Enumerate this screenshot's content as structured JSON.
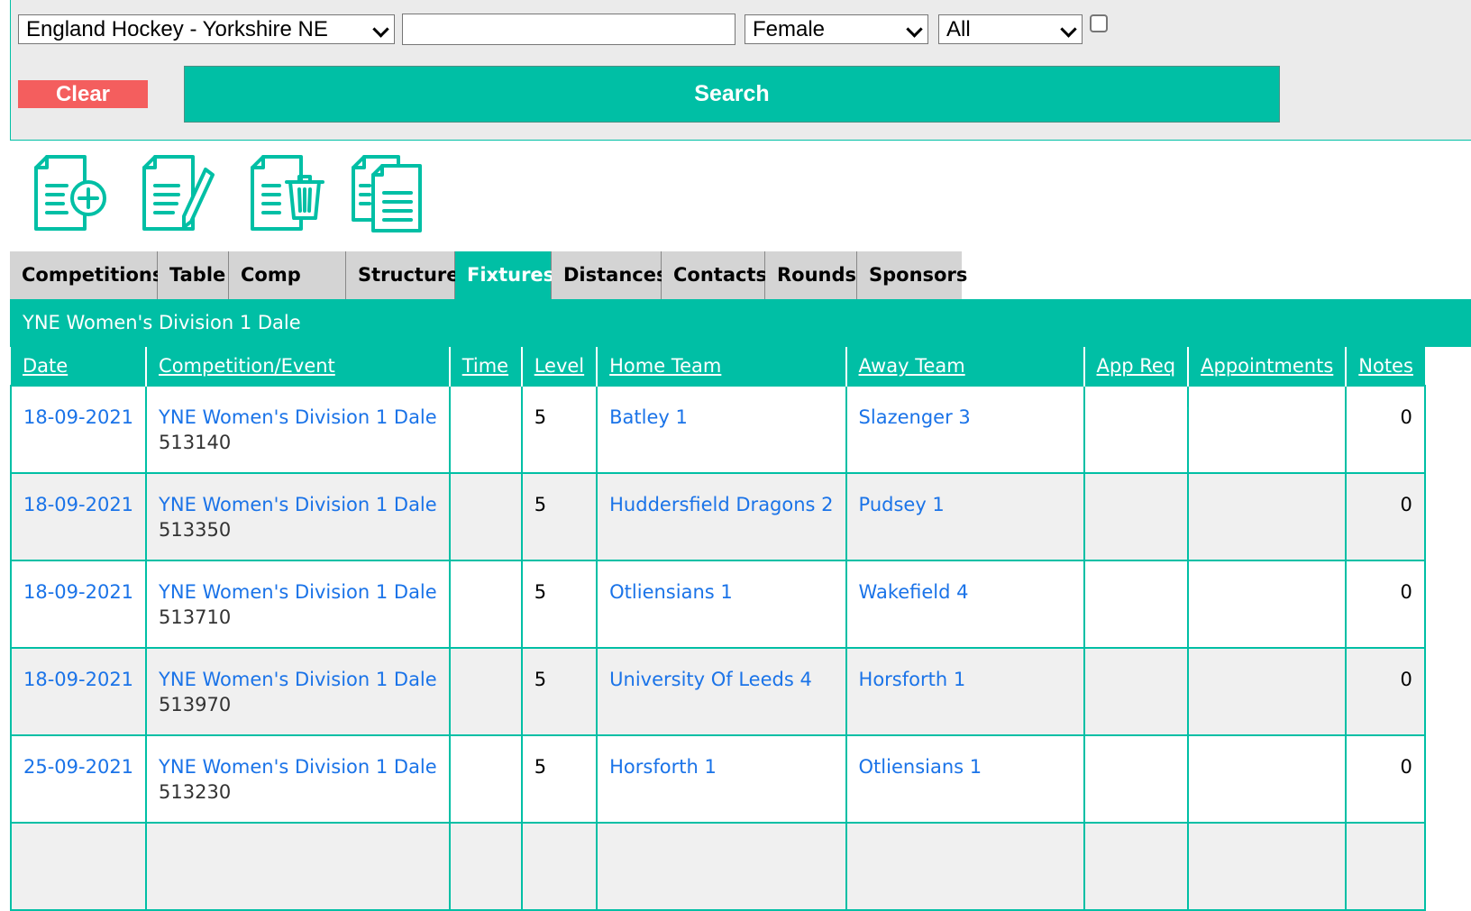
{
  "filters": {
    "association": "England Hockey - Yorkshire NE",
    "search_text": "",
    "gender": "Female",
    "scope": "All",
    "clear_label": "Clear",
    "search_label": "Search"
  },
  "toolbar_icons": [
    "add-document-icon",
    "edit-document-icon",
    "delete-document-icon",
    "copy-document-icon"
  ],
  "tabs": [
    {
      "label": "Competitions",
      "active": false
    },
    {
      "label": "Table",
      "active": false
    },
    {
      "label": "Comp Ent.",
      "active": false
    },
    {
      "label": "Structure",
      "active": false
    },
    {
      "label": "Fixtures",
      "active": true
    },
    {
      "label": "Distances",
      "active": false
    },
    {
      "label": "Contacts",
      "active": false
    },
    {
      "label": "Rounds",
      "active": false
    },
    {
      "label": "Sponsors",
      "active": false
    }
  ],
  "group_title": "YNE Women's Division 1 Dale",
  "columns": [
    "Date",
    "Competition/Event",
    "Time",
    "Level",
    "Home Team",
    "Away Team",
    "App Req",
    "Appointments",
    "Notes"
  ],
  "rows": [
    {
      "date": "18-09-2021",
      "competition": "YNE Women's Division 1 Dale",
      "event_id": "513140",
      "time": "",
      "level": "5",
      "home": "Batley 1",
      "away": "Slazenger 3",
      "app_req": "",
      "appointments": "",
      "notes": "0"
    },
    {
      "date": "18-09-2021",
      "competition": "YNE Women's Division 1 Dale",
      "event_id": "513350",
      "time": "",
      "level": "5",
      "home": "Huddersfield Dragons 2",
      "away": "Pudsey 1",
      "app_req": "",
      "appointments": "",
      "notes": "0"
    },
    {
      "date": "18-09-2021",
      "competition": "YNE Women's Division 1 Dale",
      "event_id": "513710",
      "time": "",
      "level": "5",
      "home": "Otliensians 1",
      "away": "Wakefield 4",
      "app_req": "",
      "appointments": "",
      "notes": "0"
    },
    {
      "date": "18-09-2021",
      "competition": "YNE Women's Division 1 Dale",
      "event_id": "513970",
      "time": "",
      "level": "5",
      "home": "University Of Leeds 4",
      "away": "Horsforth 1",
      "app_req": "",
      "appointments": "",
      "notes": "0"
    },
    {
      "date": "25-09-2021",
      "competition": "YNE Women's Division 1 Dale",
      "event_id": "513230",
      "time": "",
      "level": "5",
      "home": "Horsforth 1",
      "away": "Otliensians 1",
      "app_req": "",
      "appointments": "",
      "notes": "0"
    },
    {
      "date": "",
      "competition": "",
      "event_id": "",
      "time": "",
      "level": "",
      "home": "",
      "away": "",
      "app_req": "",
      "appointments": "",
      "notes": ""
    }
  ],
  "colors": {
    "accent": "#00bfa5",
    "clear": "#f45e5e",
    "link": "#1a73e8"
  }
}
